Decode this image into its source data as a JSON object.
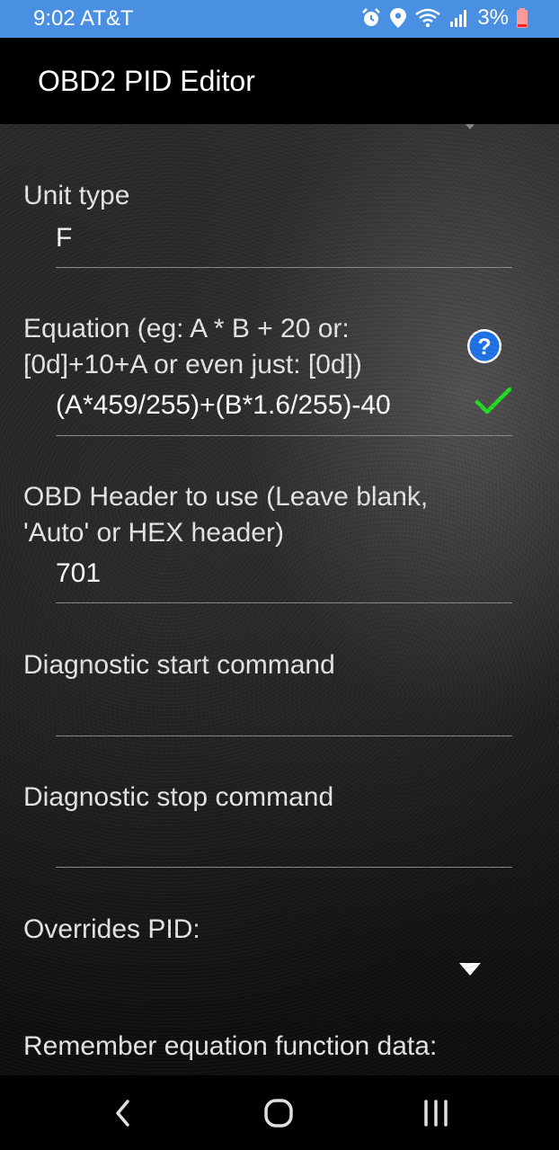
{
  "status": {
    "time": "9:02",
    "carrier": "AT&T",
    "battery": "3%"
  },
  "app": {
    "title": "OBD2 PID Editor"
  },
  "form": {
    "unit_type": {
      "label": "Unit type",
      "value": "F"
    },
    "equation": {
      "label_line1": "Equation (eg:  A * B + 20   or:",
      "label_line2": "[0d]+10+A  or even just: [0d])",
      "value": "(A*459/255)+(B*1.6/255)-40"
    },
    "obd_header": {
      "label_line1": "OBD Header to use (Leave blank,",
      "label_line2": "'Auto' or HEX header)",
      "value": "701"
    },
    "diag_start": {
      "label": "Diagnostic start command",
      "value": ""
    },
    "diag_stop": {
      "label": "Diagnostic stop command",
      "value": ""
    },
    "overrides": {
      "label": "Overrides PID:",
      "value": ""
    },
    "remember": {
      "label": "Remember equation function data:"
    }
  },
  "icons": {
    "help": "help-circle-icon",
    "valid": "checkmark-icon",
    "dropdown": "triangle-down-icon",
    "nav_back": "back-icon",
    "nav_home": "home-icon",
    "nav_recents": "recents-icon"
  },
  "colors": {
    "status_bar": "#4a90e2",
    "help": "#1e73e8",
    "check": "#22dd22"
  }
}
